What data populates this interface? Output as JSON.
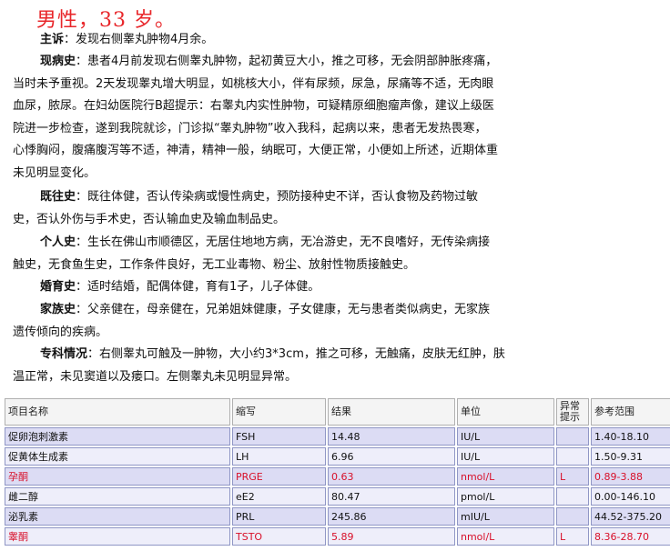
{
  "record": {
    "heading": "男性，33 岁。",
    "sections": [
      {
        "label": "主诉",
        "text": "发现右侧睾丸肿物4月余。"
      },
      {
        "label": "现病史",
        "lines": [
          "患者4月前发现右侧睾丸肿物，起初黄豆大小，推之可移，无会阴部肿胀疼痛，",
          "当时未予重视。2天发现睾丸增大明显，如桃核大小，伴有尿频，尿急，尿痛等不适，无肉眼",
          "血尿，脓尿。在妇幼医院行B超提示：右睾丸内实性肿物，可疑精原细胞瘤声像，建议上级医",
          "院进一步检查，遂到我院就诊，门诊拟“睾丸肿物”收入我科，起病以来，患者无发热畏寒，",
          "心悸胸闷，腹痛腹泻等不适，神清，精神一般，纳眠可，大便正常，小便如上所述，近期体重",
          "未见明显变化。"
        ]
      },
      {
        "label": "既往史",
        "lines": [
          "既往体健，否认传染病或慢性病史，预防接种史不详，否认食物及药物过敏",
          "史，否认外伤与手术史，否认输血史及输血制品史。"
        ]
      },
      {
        "label": "个人史",
        "lines": [
          "生长在佛山市顺德区，无居住地地方病，无冶游史，无不良嗜好，无传染病接",
          "触史，无食鱼生史，工作条件良好，无工业毒物、粉尘、放射性物质接触史。"
        ]
      },
      {
        "label": "婚育史",
        "lines": [
          "适时结婚，配偶体健，育有1子，儿子体健。"
        ]
      },
      {
        "label": "家族史",
        "lines": [
          "父亲健在，母亲健在，兄弟姐妹健康，子女健康，无与患者类似病史，无家族",
          "遗传倾向的疾病。"
        ]
      },
      {
        "label": "专科情况",
        "lines": [
          "右侧睾丸可触及一肿物，大小约3*3cm，推之可移，无触痛，皮肤无红肿，肤",
          "温正常，未见窦道以及瘘口。左侧睾丸未见明显异常。"
        ]
      }
    ]
  },
  "lab": {
    "headers": {
      "name": "项目名称",
      "abbr": "缩写",
      "result": "结果",
      "unit": "单位",
      "flag_line1": "异常",
      "flag_line2": "提示",
      "range": "参考范围"
    },
    "rows": [
      {
        "name": "促卵泡刺激素",
        "abbr": "FSH",
        "result": "14.48",
        "unit": "IU/L",
        "flag": "",
        "range": "1.40-18.10"
      },
      {
        "name": "促黄体生成素",
        "abbr": "LH",
        "result": "6.96",
        "unit": "IU/L",
        "flag": "",
        "range": "1.50-9.31"
      },
      {
        "name": "孕酮",
        "abbr": "PRGE",
        "result": "0.63",
        "unit": "nmol/L",
        "flag": "L",
        "range": "0.89-3.88"
      },
      {
        "name": "雌二醇",
        "abbr": "eE2",
        "result": "80.47",
        "unit": "pmol/L",
        "flag": "",
        "range": "0.00-146.10"
      },
      {
        "name": "泌乳素",
        "abbr": "PRL",
        "result": "245.86",
        "unit": "mIU/L",
        "flag": "",
        "range": "44.52-375.20"
      },
      {
        "name": "睾酮",
        "abbr": "TSTO",
        "result": "5.89",
        "unit": "nmol/L",
        "flag": "L",
        "range": "8.36-28.70"
      }
    ],
    "colors": {
      "abnormal": "#d8102a",
      "row_odd": "#dcdcf4",
      "row_even": "#eeeefa",
      "border": "#8f96c5"
    }
  }
}
